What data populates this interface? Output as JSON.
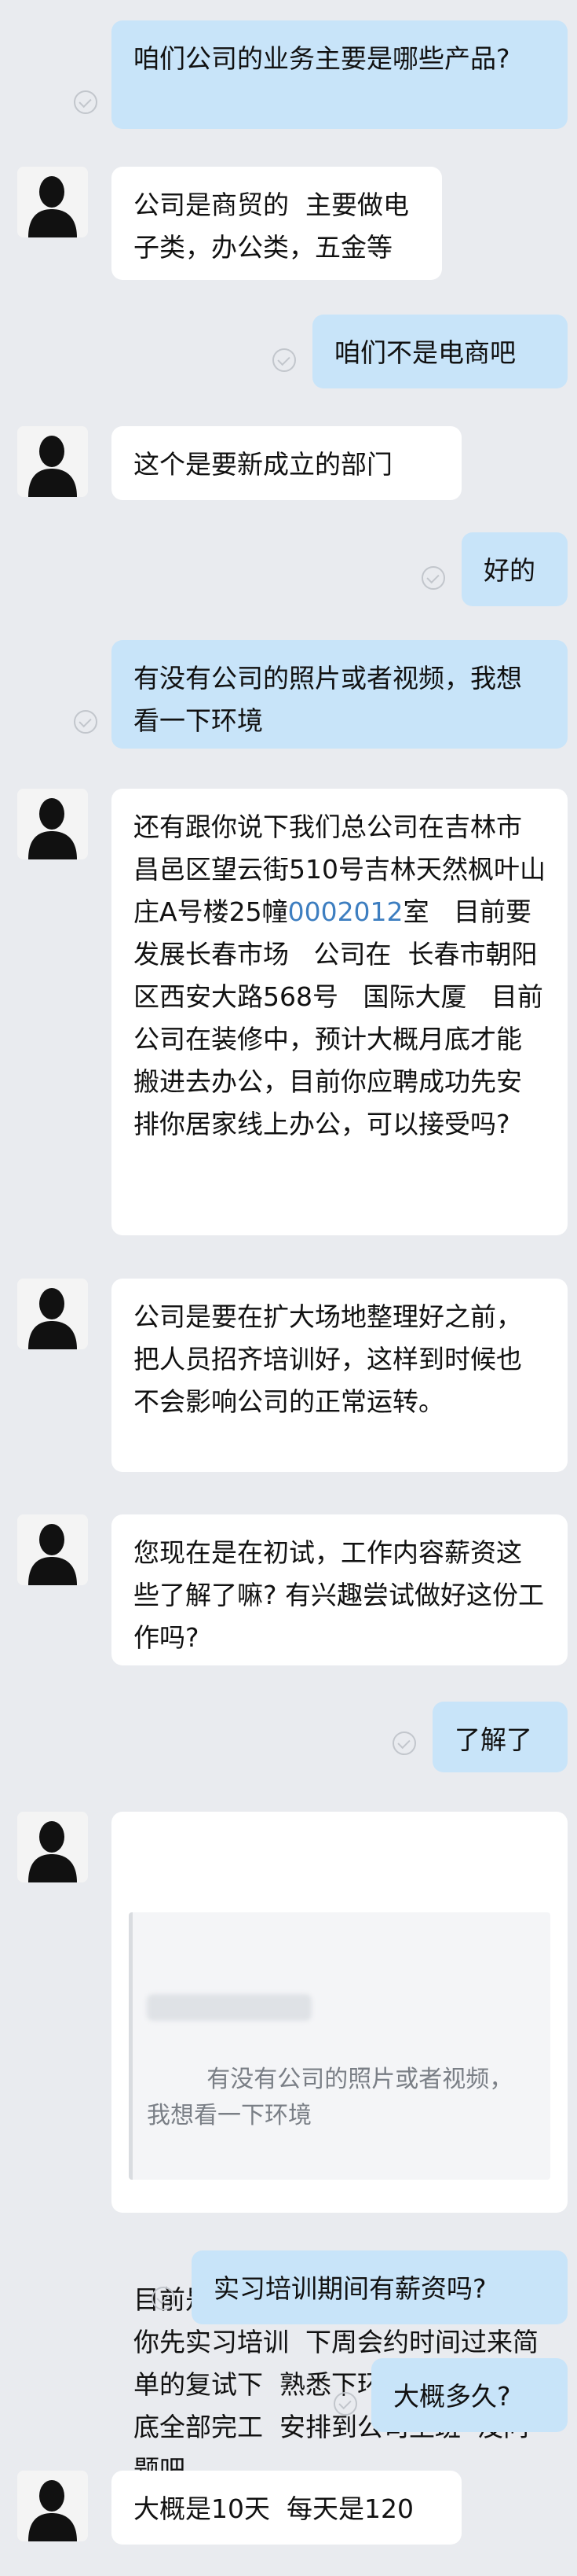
{
  "messages": [
    {
      "id": 1,
      "side": "out",
      "text": "咱们公司的业务主要是哪些产品?"
    },
    {
      "id": 2,
      "side": "in",
      "text": "公司是商贸的  主要做电子类，办公类，五金等"
    },
    {
      "id": 3,
      "side": "out",
      "text": "咱们不是电商吧"
    },
    {
      "id": 4,
      "side": "in",
      "text": "这个是要新成立的部门"
    },
    {
      "id": 5,
      "side": "out",
      "text": "好的"
    },
    {
      "id": 6,
      "side": "out",
      "text": "有没有公司的照片或者视频，我想看一下环境"
    },
    {
      "id": 7,
      "side": "in",
      "text_before_link": "还有跟你说下我们总公司在吉林市昌邑区望云街510号吉林天然枫叶山庄A号楼25幢",
      "link_text": "0002012",
      "text_after_link": "室   目前要发展长春市场   公司在  长春市朝阳区西安大路568号   国际大厦   目前公司在装修中，预计大概月底才能搬进去办公，目前你应聘成功先安排你居家线上办公，可以接受吗?"
    },
    {
      "id": 8,
      "side": "in",
      "text": "公司是要在扩大场地整理好之前，把人员招齐培训好，这样到时候也不会影响公司的正常运转。"
    },
    {
      "id": 9,
      "side": "in",
      "text": "您现在是在初试，工作内容薪资这些了解了嘛? 有兴趣尝试做好这份工作吗?"
    },
    {
      "id": 10,
      "side": "out",
      "text": "了解了"
    },
    {
      "id": 11,
      "side": "in",
      "quoted_text": "有没有公司的照片或者视频，我想看一下环境",
      "text": "目前是公司在扩大整理中没照片呢  你先实习培训  下周会约时间过来简单的复试下  熟悉下环境  然后等月底全部完工  安排到公司坐班  没问题吧"
    },
    {
      "id": 12,
      "side": "out",
      "text": "实习培训期间有薪资吗?"
    },
    {
      "id": 13,
      "side": "out",
      "text": "大概多久?"
    },
    {
      "id": 14,
      "side": "in",
      "text": "大概是10天  每天是120"
    }
  ]
}
